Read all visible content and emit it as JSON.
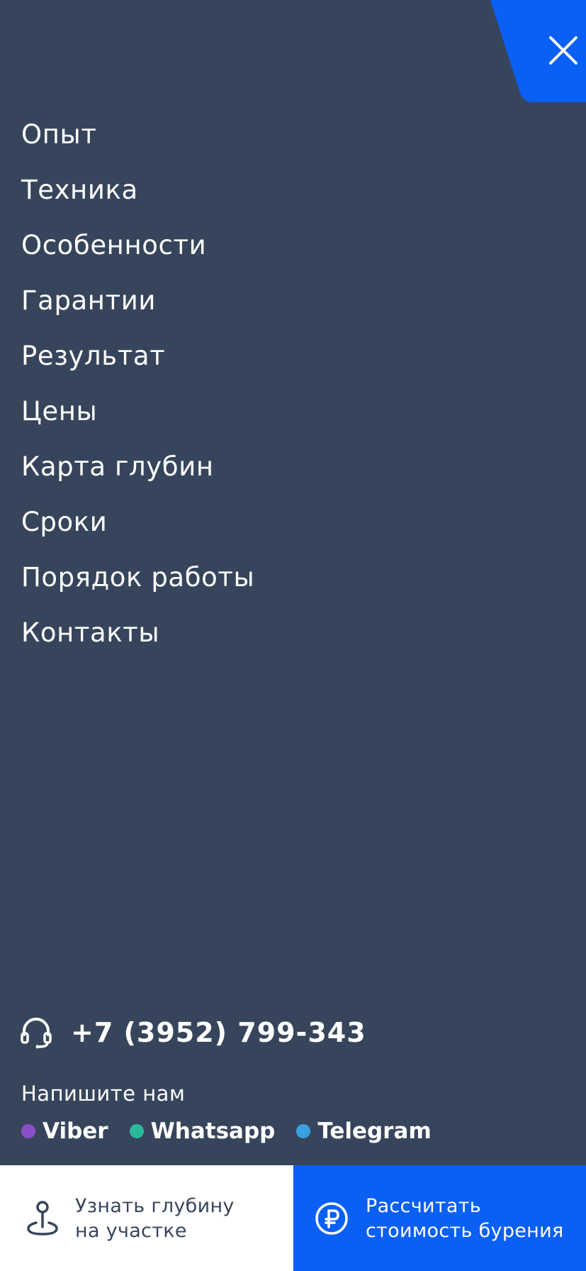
{
  "colors": {
    "background": "#37455c",
    "accent": "#0a5ff5",
    "text": "#ffffff",
    "viber": "#8a4fc8",
    "whatsapp": "#2bb89a",
    "telegram": "#3aa0e0"
  },
  "menu": {
    "items": [
      {
        "label": "Опыт"
      },
      {
        "label": "Техника"
      },
      {
        "label": "Особенности"
      },
      {
        "label": "Гарантии"
      },
      {
        "label": "Результат"
      },
      {
        "label": "Цены"
      },
      {
        "label": "Карта глубин"
      },
      {
        "label": "Сроки"
      },
      {
        "label": "Порядок работы"
      },
      {
        "label": "Контакты"
      }
    ]
  },
  "contact": {
    "phone": "+7 (3952)  799-343",
    "write_label": "Напишите нам",
    "messengers": [
      {
        "label": "Viber",
        "color": "#8a4fc8"
      },
      {
        "label": "Whatsapp",
        "color": "#2bb89a"
      },
      {
        "label": "Telegram",
        "color": "#3aa0e0"
      }
    ]
  },
  "actions": {
    "depth": {
      "line1": "Узнать глубину",
      "line2": "на участке",
      "icon": "location-pin-icon"
    },
    "cost": {
      "line1": "Рассчитать",
      "line2": "стоимость бурения",
      "icon": "ruble-icon"
    }
  }
}
